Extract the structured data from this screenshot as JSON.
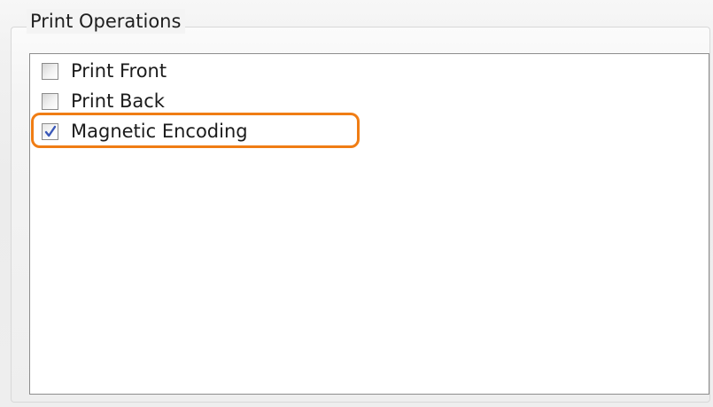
{
  "group": {
    "title": "Print Operations"
  },
  "options": [
    {
      "label": "Print Front",
      "checked": false
    },
    {
      "label": "Print Back",
      "checked": false
    },
    {
      "label": "Magnetic Encoding",
      "checked": true
    }
  ],
  "colors": {
    "highlight": "#f07d14",
    "checkmark": "#3a58b8",
    "panel_border": "#8d8d8d"
  }
}
